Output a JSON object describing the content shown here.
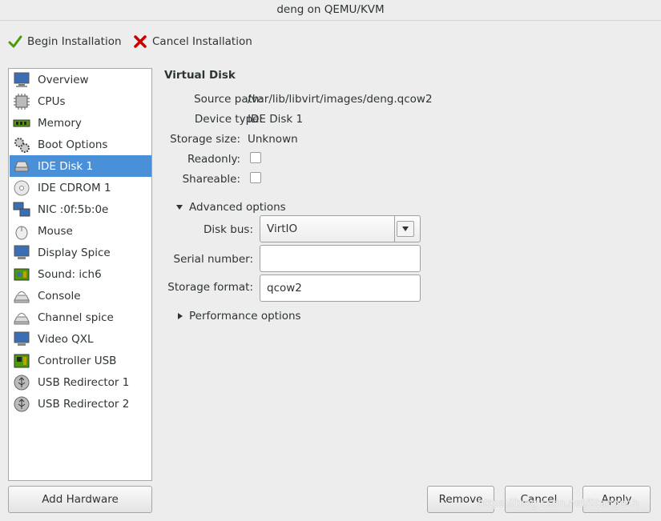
{
  "window": {
    "title": "deng on QEMU/KVM"
  },
  "toolbar": {
    "begin_label": "Begin Installation",
    "cancel_label": "Cancel Installation"
  },
  "hardware": {
    "items": [
      {
        "label": "Overview",
        "icon": "monitor-icon"
      },
      {
        "label": "CPUs",
        "icon": "cpu-icon"
      },
      {
        "label": "Memory",
        "icon": "memory-icon"
      },
      {
        "label": "Boot Options",
        "icon": "gears-icon"
      },
      {
        "label": "IDE Disk 1",
        "icon": "disk-icon",
        "selected": true
      },
      {
        "label": "IDE CDROM 1",
        "icon": "cdrom-icon"
      },
      {
        "label": "NIC :0f:5b:0e",
        "icon": "network-icon"
      },
      {
        "label": "Mouse",
        "icon": "mouse-icon"
      },
      {
        "label": "Display Spice",
        "icon": "display-icon"
      },
      {
        "label": "Sound: ich6",
        "icon": "sound-icon"
      },
      {
        "label": "Console",
        "icon": "console-icon"
      },
      {
        "label": "Channel spice",
        "icon": "channel-icon"
      },
      {
        "label": "Video QXL",
        "icon": "video-icon"
      },
      {
        "label": "Controller USB",
        "icon": "controller-icon"
      },
      {
        "label": "USB Redirector 1",
        "icon": "usb-icon"
      },
      {
        "label": "USB Redirector 2",
        "icon": "usb-icon"
      }
    ],
    "add_label": "Add Hardware"
  },
  "disk": {
    "title": "Virtual Disk",
    "source_path_label": "Source path:",
    "source_path": "/var/lib/libvirt/images/deng.qcow2",
    "device_type_label": "Device type:",
    "device_type": "IDE Disk 1",
    "storage_size_label": "Storage size:",
    "storage_size": "Unknown",
    "readonly_label": "Readonly:",
    "readonly": false,
    "shareable_label": "Shareable:",
    "shareable": false
  },
  "advanced": {
    "label": "Advanced options",
    "disk_bus_label": "Disk bus:",
    "disk_bus": "VirtIO",
    "serial_label": "Serial number:",
    "serial_value": "",
    "format_label": "Storage format:",
    "format_value": "qcow2"
  },
  "performance": {
    "label": "Performance options"
  },
  "buttons": {
    "remove": "Remove",
    "cancel": "Cancel",
    "apply": "Apply"
  },
  "watermark": "https://blog.csdn.net/Stanger.h"
}
